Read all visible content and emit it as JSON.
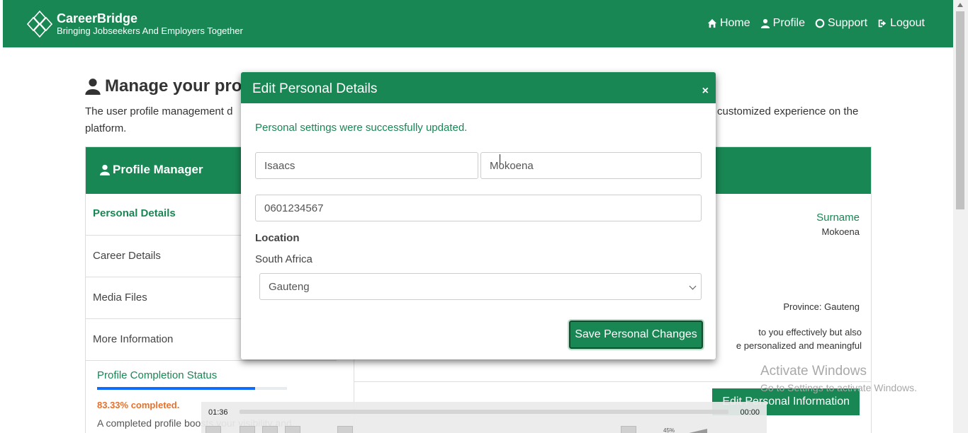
{
  "navbar": {
    "brand_name": "CareerBridge",
    "brand_tagline": "Bringing Jobseekers And Employers Together",
    "links": [
      {
        "label": "Home",
        "icon": "home-icon"
      },
      {
        "label": "Profile",
        "icon": "user-icon"
      },
      {
        "label": "Support",
        "icon": "life-ring-icon"
      },
      {
        "label": "Logout",
        "icon": "logout-icon"
      }
    ]
  },
  "page": {
    "title": "Manage your pro",
    "description_left": "The user profile management d",
    "description_right": "customized experience on the",
    "description_line2": "platform."
  },
  "profile_manager": {
    "title": "Profile Manager",
    "sidebar": [
      "Personal Details",
      "Career Details",
      "Media Files",
      "More Information"
    ],
    "completion": {
      "title": "Profile Completion Status",
      "percent": 83.33,
      "percent_label": "83.33% completed.",
      "note": "A completed profile boosts your visibility and"
    },
    "details": {
      "surname_label": "Surname",
      "surname_value": "Mokoena",
      "province": "Province: Gauteng",
      "info_line1": "to you effectively but also",
      "info_line2": "e personalized and meaningful"
    },
    "edit_button": "Edit Personal Information"
  },
  "modal": {
    "title": "Edit Personal Details",
    "close_label": "×",
    "success_message": "Personal settings were successfully updated.",
    "first_name": "Isaacs",
    "last_name": "Mokoena",
    "phone": "0601234567",
    "location_label": "Location",
    "country": "South Africa",
    "province_selected": "Gauteng",
    "save_button": "Save Personal Changes"
  },
  "watermark": {
    "title": "Activate Windows",
    "subtitle": "Go to Settings to activate Windows."
  },
  "player": {
    "elapsed": "01:36",
    "remaining": "00:00",
    "volume": "45%"
  },
  "colors": {
    "brand_green": "#198754",
    "progress_blue": "#0d6efd",
    "completion_orange": "#e8702a"
  }
}
